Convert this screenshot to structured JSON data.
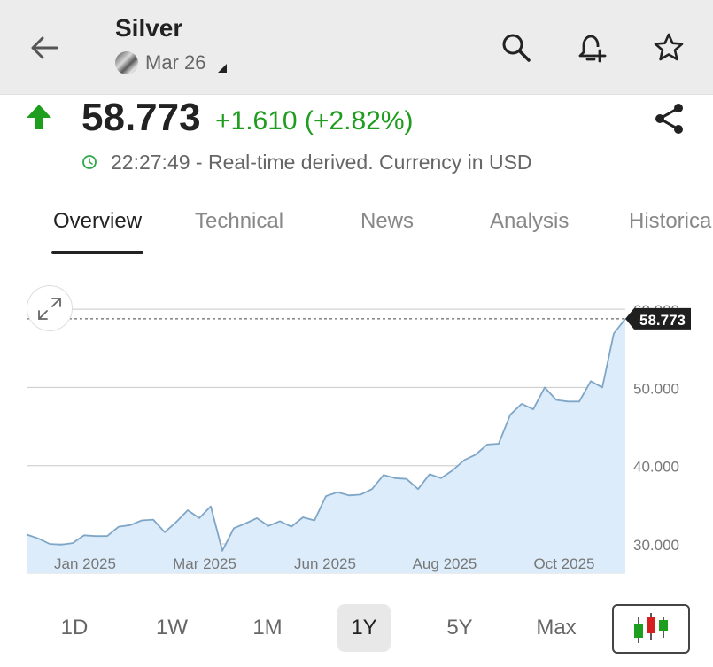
{
  "header": {
    "title": "Silver",
    "contract": "Mar 26",
    "icons": [
      "back-arrow-icon",
      "search-icon",
      "add-alert-icon",
      "star-icon"
    ]
  },
  "quote": {
    "price": "58.773",
    "change": "+1.610 (+2.82%)",
    "timestamp": "22:27:49 - Real-time derived. Currency in USD",
    "direction": "up",
    "up_color": "#1f9d1f"
  },
  "tabs": [
    {
      "label": "Overview",
      "active": true
    },
    {
      "label": "Technical",
      "active": false
    },
    {
      "label": "News",
      "active": false
    },
    {
      "label": "Analysis",
      "active": false
    },
    {
      "label": "Historica",
      "active": false
    }
  ],
  "ranges": [
    {
      "label": "1D",
      "active": false
    },
    {
      "label": "1W",
      "active": false
    },
    {
      "label": "1M",
      "active": false
    },
    {
      "label": "1Y",
      "active": true
    },
    {
      "label": "5Y",
      "active": false
    },
    {
      "label": "Max",
      "active": false
    }
  ],
  "chart_data": {
    "type": "area",
    "title": "",
    "xlabel": "",
    "ylabel": "",
    "ylim": [
      30,
      60
    ],
    "y_ticks": [
      "60.000",
      "50.000",
      "40.000",
      "30.000"
    ],
    "y_tick_values": [
      60,
      50,
      40,
      30
    ],
    "x_ticks": [
      "Jan 2025",
      "Mar 2025",
      "Jun 2025",
      "Aug 2025",
      "Oct 2025"
    ],
    "last_value_label": "58.773",
    "last_value": 58.773,
    "grid": true,
    "line_color": "#7fa6c7",
    "fill_color": "#dcecfa",
    "series": [
      {
        "values": [
          31.2,
          30.7,
          30.0,
          29.9,
          30.1,
          31.1,
          31.0,
          31.0,
          32.2,
          32.4,
          33.0,
          33.1,
          31.5,
          32.8,
          34.3,
          33.3,
          34.8,
          29.1,
          32.0,
          32.6,
          33.3,
          32.3,
          32.9,
          32.2,
          33.4,
          33.0,
          36.1,
          36.6,
          36.2,
          36.3,
          37.0,
          38.8,
          38.4,
          38.3,
          37.0,
          38.9,
          38.4,
          39.4,
          40.7,
          41.4,
          42.7,
          42.8,
          46.5,
          47.9,
          47.2,
          50.0,
          48.4,
          48.2,
          48.2,
          50.8,
          50.0,
          56.9,
          58.773
        ]
      }
    ]
  }
}
